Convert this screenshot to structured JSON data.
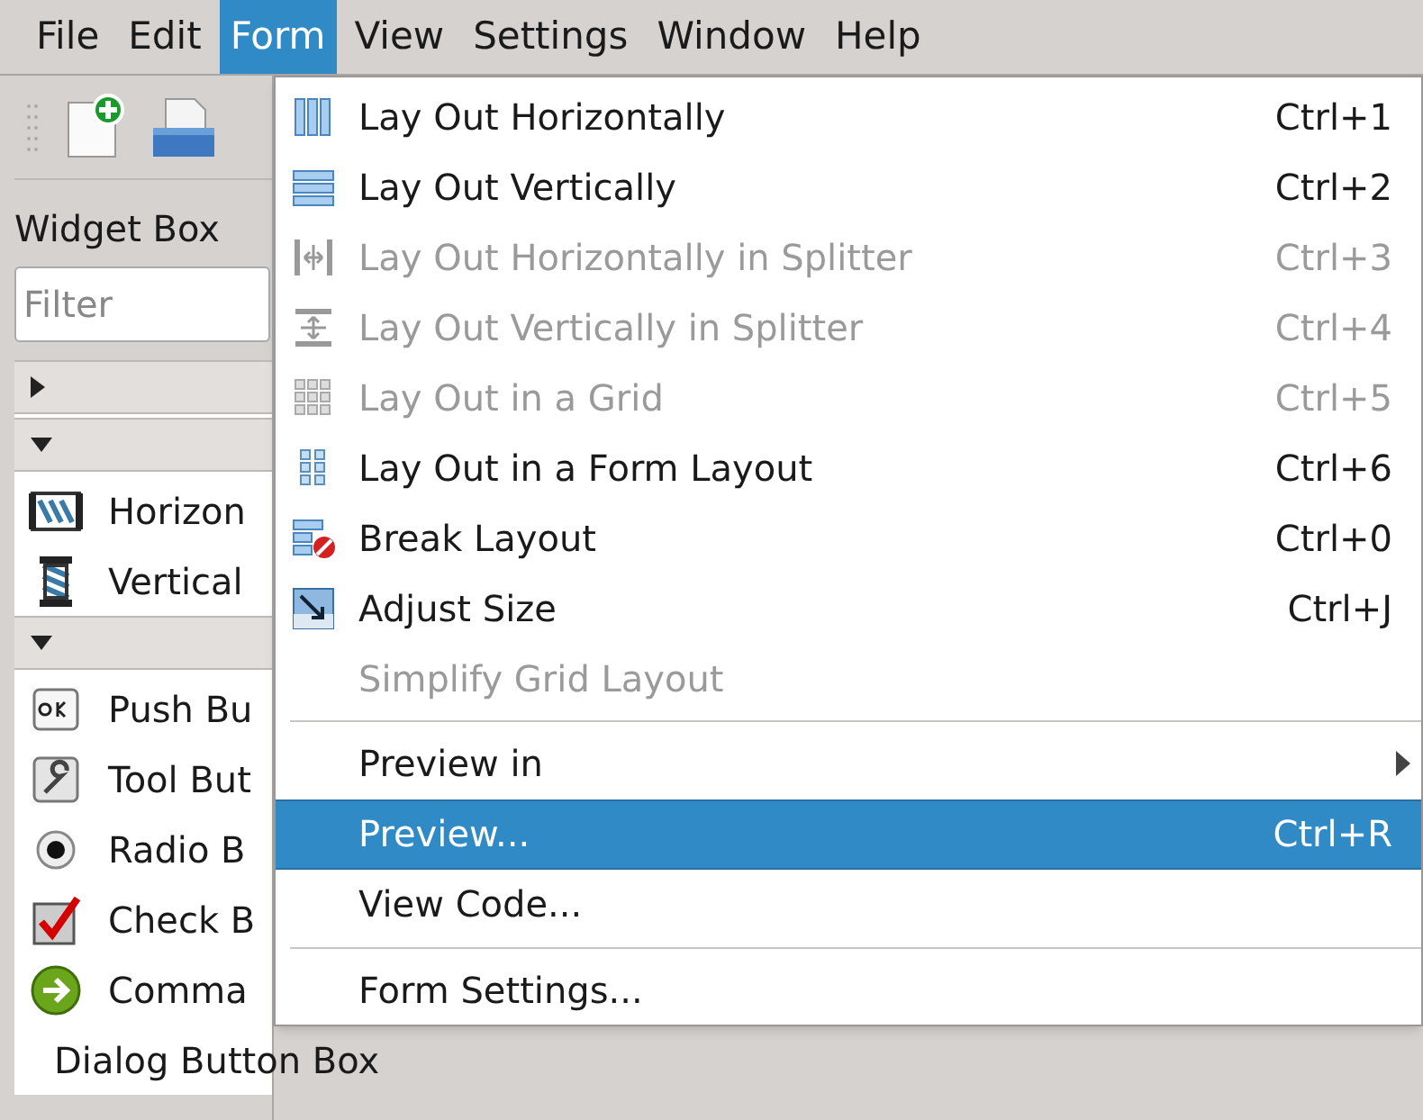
{
  "menubar": [
    {
      "label": "File",
      "selected": false
    },
    {
      "label": "Edit",
      "selected": false
    },
    {
      "label": "Form",
      "selected": true
    },
    {
      "label": "View",
      "selected": false
    },
    {
      "label": "Settings",
      "selected": false
    },
    {
      "label": "Window",
      "selected": false
    },
    {
      "label": "Help",
      "selected": false
    }
  ],
  "widget_box": {
    "title": "Widget Box",
    "filter": {
      "placeholder": "Filter"
    },
    "rows": [
      {
        "kind": "category",
        "expanded": false
      },
      {
        "kind": "category",
        "expanded": true
      },
      {
        "kind": "widget",
        "label": "Horizon"
      },
      {
        "kind": "widget",
        "label": "Vertical"
      },
      {
        "kind": "category",
        "expanded": true
      },
      {
        "kind": "widget",
        "label": "Push Bu"
      },
      {
        "kind": "widget",
        "label": "Tool But"
      },
      {
        "kind": "widget",
        "label": "Radio B"
      },
      {
        "kind": "widget",
        "label": "Check B"
      },
      {
        "kind": "widget",
        "label": "Comma"
      },
      {
        "kind": "widget",
        "label": "Dialog Button Box"
      }
    ]
  },
  "form_menu": [
    {
      "kind": "action",
      "label": "Lay Out Horizontally",
      "shortcut": "Ctrl+1",
      "disabled": false,
      "selected": false
    },
    {
      "kind": "action",
      "label": "Lay Out Vertically",
      "shortcut": "Ctrl+2",
      "disabled": false,
      "selected": false
    },
    {
      "kind": "action",
      "label": "Lay Out Horizontally in Splitter",
      "shortcut": "Ctrl+3",
      "disabled": true,
      "selected": false
    },
    {
      "kind": "action",
      "label": "Lay Out Vertically in Splitter",
      "shortcut": "Ctrl+4",
      "disabled": true,
      "selected": false
    },
    {
      "kind": "action",
      "label": "Lay Out in a Grid",
      "shortcut": "Ctrl+5",
      "disabled": true,
      "selected": false
    },
    {
      "kind": "action",
      "label": "Lay Out in a Form Layout",
      "shortcut": "Ctrl+6",
      "disabled": false,
      "selected": false
    },
    {
      "kind": "action",
      "label": "Break Layout",
      "shortcut": "Ctrl+0",
      "disabled": false,
      "selected": false
    },
    {
      "kind": "action",
      "label": "Adjust Size",
      "shortcut": "Ctrl+J",
      "disabled": false,
      "selected": false
    },
    {
      "kind": "action",
      "label": "Simplify Grid Layout",
      "disabled": true,
      "selected": false
    },
    {
      "kind": "separator"
    },
    {
      "kind": "submenu",
      "label": "Preview in",
      "disabled": false,
      "selected": false
    },
    {
      "kind": "action",
      "label": "Preview...",
      "shortcut": "Ctrl+R",
      "disabled": false,
      "selected": true
    },
    {
      "kind": "action",
      "label": "View Code...",
      "disabled": false,
      "selected": false
    },
    {
      "kind": "separator"
    },
    {
      "kind": "action",
      "label": "Form Settings...",
      "disabled": false,
      "selected": false
    }
  ]
}
